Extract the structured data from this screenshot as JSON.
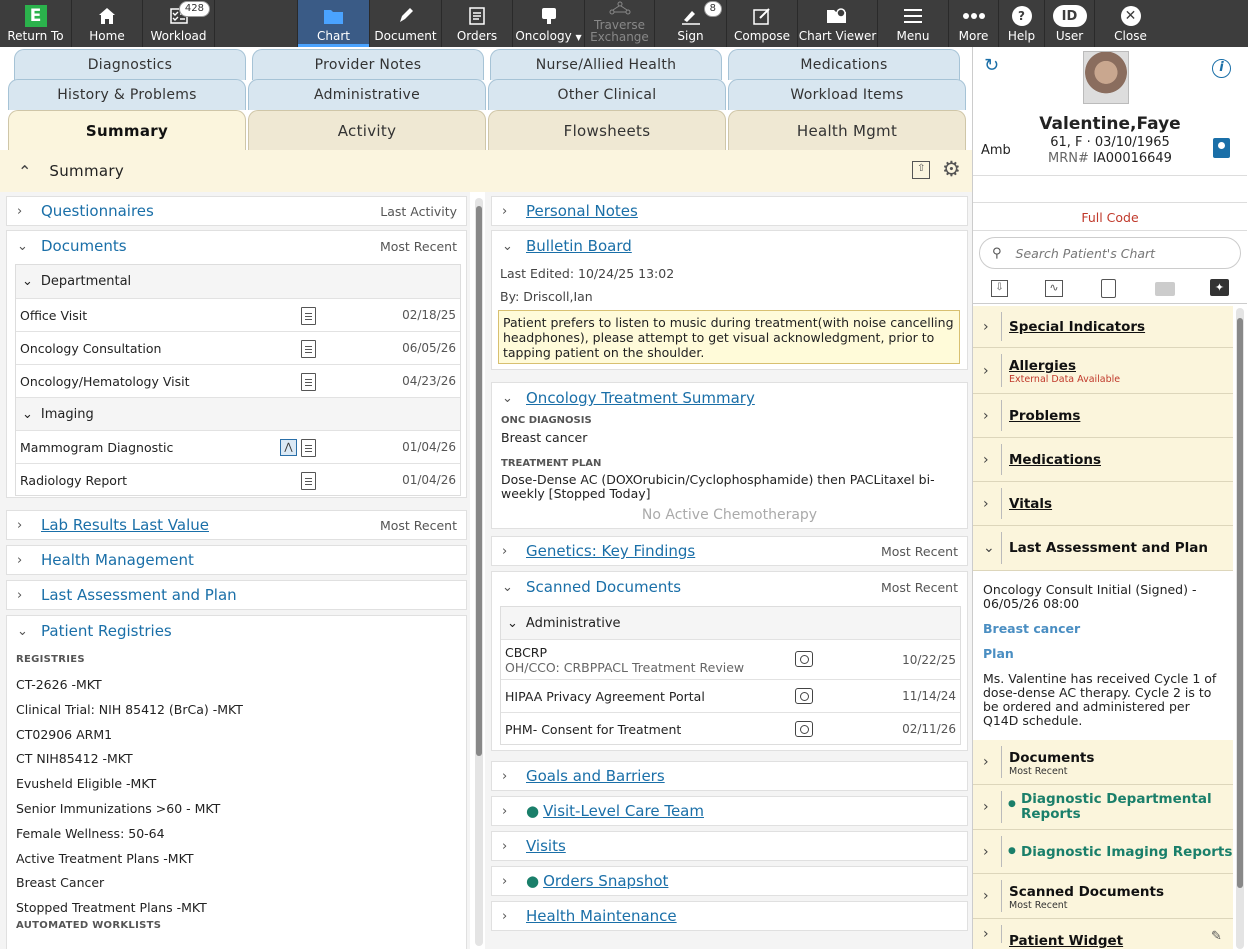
{
  "toolbar": {
    "return_to": "Return To",
    "home": "Home",
    "workload": "Workload",
    "workload_count": "428",
    "chart": "Chart",
    "document": "Document",
    "orders": "Orders",
    "oncology": "Oncology",
    "traverse": "Traverse",
    "exchange": "Exchange",
    "sign": "Sign",
    "sign_count": "8",
    "compose": "Compose",
    "chart_viewer": "Chart Viewer",
    "menu": "Menu",
    "more": "More",
    "help": "Help",
    "user_icon": "ID",
    "user": "User",
    "close": "Close"
  },
  "tabs": {
    "row1": [
      "Diagnostics",
      "Provider Notes",
      "Nurse/Allied Health",
      "Medications"
    ],
    "row2": [
      "History & Problems",
      "Administrative",
      "Other Clinical",
      "Workload Items"
    ],
    "row3": [
      "Summary",
      "Activity",
      "Flowsheets",
      "Health Mgmt"
    ]
  },
  "summary": {
    "title": "Summary"
  },
  "left": {
    "questionnaires": {
      "title": "Questionnaires",
      "right": "Last Activity"
    },
    "documents": {
      "title": "Documents",
      "right": "Most Recent",
      "dept_label": "Departmental",
      "imaging_label": "Imaging",
      "dept_rows": [
        {
          "name": "Office Visit",
          "date": "02/18/25"
        },
        {
          "name": "Oncology Consultation",
          "date": "06/05/26"
        },
        {
          "name": "Oncology/Hematology Visit",
          "date": "04/23/26"
        }
      ],
      "imaging_rows": [
        {
          "name": "Mammogram Diagnostic",
          "date": "01/04/26"
        },
        {
          "name": "Radiology Report",
          "date": "01/04/26"
        }
      ]
    },
    "lab": {
      "title": "Lab Results Last Value",
      "right": "Most Recent"
    },
    "health": {
      "title": "Health Management"
    },
    "lap": {
      "title": "Last Assessment and Plan"
    },
    "registries": {
      "title": "Patient Registries",
      "label": "REGISTRIES",
      "items": [
        "CT-2626 -MKT",
        "Clinical Trial: NIH 85412 (BrCa) -MKT",
        "CT02906 ARM1",
        "CT NIH85412 -MKT",
        "Evusheld Eligible -MKT",
        "Senior Immunizations >60 - MKT",
        "Female Wellness: 50-64",
        "Active Treatment Plans -MKT",
        "Breast Cancer",
        "Stopped Treatment Plans -MKT"
      ],
      "worklists_label": "AUTOMATED WORKLISTS"
    }
  },
  "mid": {
    "personal": {
      "title": "Personal Notes"
    },
    "bulletin": {
      "title": "Bulletin Board",
      "edited": "Last Edited: 10/24/25 13:02",
      "by": "By: Driscoll,Ian",
      "note": "Patient prefers to listen to music during treatment(with noise cancelling headphones), please attempt to get visual acknowledgment, prior to tapping patient on the shoulder."
    },
    "onc": {
      "title": "Oncology Treatment Summary",
      "dx_label": "ONC DIAGNOSIS",
      "dx": "Breast cancer",
      "plan_label": "TREATMENT PLAN",
      "plan": "Dose-Dense AC (DOXOrubicin/Cyclophosphamide) then PACLitaxel bi-weekly [Stopped Today]",
      "chemo": "No Active Chemotherapy"
    },
    "genetics": {
      "title": "Genetics: Key Findings",
      "right": "Most Recent"
    },
    "scanned": {
      "title": "Scanned Documents",
      "right": "Most Recent",
      "group": "Administrative",
      "rows": [
        {
          "name": "CBCRP",
          "sub": "OH/CCO: CRBPPACL Treatment Review",
          "date": "10/22/25"
        },
        {
          "name": "HIPAA Privacy Agreement Portal",
          "sub": "",
          "date": "11/14/24"
        },
        {
          "name": "PHM- Consent for Treatment",
          "sub": "",
          "date": "02/11/26"
        }
      ]
    },
    "goals": {
      "title": "Goals and Barriers"
    },
    "care_team": {
      "title": "Visit-Level Care Team"
    },
    "visits": {
      "title": "Visits"
    },
    "orders": {
      "title": "Orders Snapshot"
    },
    "hm": {
      "title": "Health Maintenance"
    }
  },
  "patient": {
    "name": "Valentine,Faye",
    "line1": "61, F · 03/10/1965",
    "mrn_label": "MRN#",
    "mrn": "IA00016649",
    "enc": "Amb",
    "code": "Full Code",
    "search_placeholder": "Search Patient's Chart"
  },
  "side": {
    "special": "Special Indicators",
    "allergies": "Allergies",
    "allergies_sub": "External Data Available",
    "problems": "Problems",
    "medications": "Medications",
    "vitals": "Vitals",
    "lap": "Last Assessment and Plan",
    "lap_note": "Oncology Consult Initial (Signed) - 06/05/26 08:00",
    "lap_dx": "Breast cancer",
    "lap_plan_label": "Plan",
    "lap_plan": "Ms. Valentine has received Cycle 1 of dose-dense AC therapy. Cycle 2 is to be ordered and administered per Q14D schedule.",
    "documents": "Documents",
    "documents_sub": "Most Recent",
    "ddr": "Diagnostic Departmental Reports",
    "dir": "Diagnostic Imaging Reports",
    "scanned": "Scanned Documents",
    "scanned_sub": "Most Recent",
    "widget": "Patient Widget"
  },
  "colors": {
    "toolbar": "#3d3d3d",
    "link": "#1a6fa8",
    "sidebar": "#fbf5dc",
    "accent_green": "#1a7f6a",
    "code_red": "#c0392b"
  }
}
